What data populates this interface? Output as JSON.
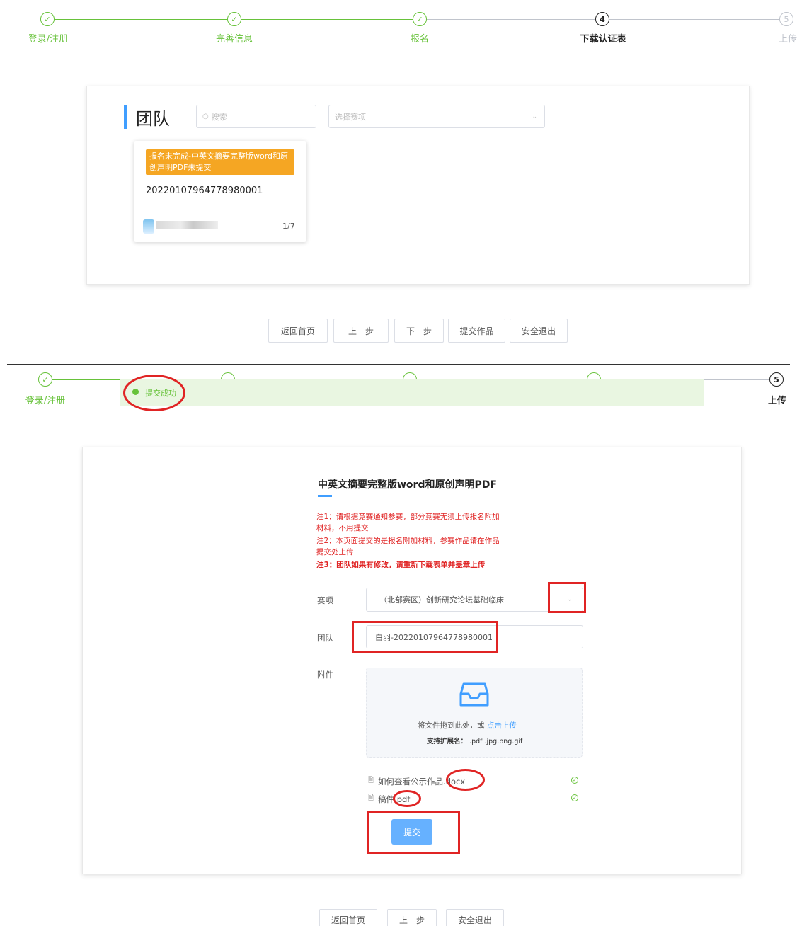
{
  "panel1": {
    "steps": [
      {
        "label": "登录/注册",
        "mark": "✓",
        "state": "done"
      },
      {
        "label": "完善信息",
        "mark": "✓",
        "state": "done"
      },
      {
        "label": "报名",
        "mark": "✓",
        "state": "done"
      },
      {
        "label": "下载认证表",
        "mark": "4",
        "state": "active"
      },
      {
        "label": "上传",
        "mark": "5",
        "state": "todo"
      }
    ],
    "section_title": "团队",
    "search_placeholder": "搜索",
    "select_placeholder": "选择赛项",
    "team_card": {
      "warning": "报名未完成-中英文摘要完整版word和原创声明PDF未提交",
      "team_id": "20220107964778980001",
      "page": "1/7"
    },
    "buttons": [
      "返回首页",
      "上一步",
      "下一步",
      "提交作品",
      "安全退出"
    ]
  },
  "panel2": {
    "steps": [
      {
        "label": "登录/注册",
        "mark": "✓",
        "state": "done"
      },
      {
        "label": "上传",
        "mark": "5",
        "state": "active"
      }
    ],
    "success_message": "提交成功",
    "form_title": "中英文摘要完整版word和原创声明PDF",
    "notes": [
      "注1：请根据竞赛通知参赛，部分竞赛无须上传报名附加材料，不用提交",
      "注2：本页面提交的是报名附加材料，参赛作品请在作品提交处上传",
      "注3：团队如果有修改，请重新下载表单并盖章上传"
    ],
    "fields": {
      "event_label": "赛项",
      "event_value": "（北部赛区）创新研究论坛基础临床",
      "team_label": "团队",
      "team_value": "白羽-20220107964778980001",
      "attachment_label": "附件"
    },
    "upload": {
      "hint_prefix": "将文件拖到此处，或",
      "hint_link": "点击上传",
      "ext_label": "支持扩展名：",
      "ext_values": ".pdf .jpg.png.gif"
    },
    "files": [
      {
        "name": "如何查看公示作品.docx"
      },
      {
        "name": "稿件.pdf"
      }
    ],
    "submit_label": "提交",
    "buttons": [
      "返回首页",
      "上一步",
      "安全退出"
    ]
  },
  "colors": {
    "success_green": "#67c23a",
    "primary_blue": "#409eff",
    "warning_orange": "#f5a623",
    "annotation_red": "#e02424"
  }
}
